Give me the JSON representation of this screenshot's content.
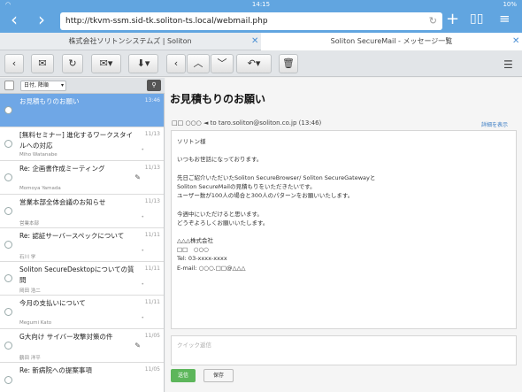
{
  "status": {
    "time": "14:15",
    "battery": "10%"
  },
  "browser": {
    "url": "http://tkvm-ssm.sid-tk.soliton-ts.local/webmail.php",
    "tabs": [
      {
        "label": "株式会社ソリトンシステムズ | Soliton"
      },
      {
        "label": "Soliton SecureMail - メッセージ一覧"
      }
    ]
  },
  "list": {
    "sort_label": "日付, 降順",
    "items": [
      {
        "subject": "お見積もりのお願い",
        "date": "13:46",
        "from": "",
        "dot": "",
        "selected": true
      },
      {
        "subject": "[無料セミナー] 進化するワークスタイルへの対応",
        "date": "11/13",
        "from": "Miho Watanabe",
        "dot": "•"
      },
      {
        "subject": "Re: 企画書作成ミーティング",
        "date": "11/13",
        "from": "Momoya Yamada",
        "dot": "",
        "clip": true
      },
      {
        "subject": "営業本部全体会議のお知らせ",
        "date": "11/13",
        "from": "営業本部",
        "dot": "•"
      },
      {
        "subject": "Re: 認証サーバースペックについて",
        "date": "11/11",
        "from": "石川 学",
        "dot": "•"
      },
      {
        "subject": "Soliton SecureDesktopについての質問",
        "date": "11/11",
        "from": "岡田 浩二",
        "dot": "•"
      },
      {
        "subject": "今月の支払いについて",
        "date": "11/11",
        "from": "Megumi Kato",
        "dot": "•"
      },
      {
        "subject": "G大向け サイバー攻撃対策の件",
        "date": "11/05",
        "from": "鶴田 洋平",
        "dot": "",
        "clip": true
      },
      {
        "subject": "Re: 新病院への提案事項",
        "date": "11/05",
        "from": "",
        "dot": ""
      }
    ]
  },
  "message": {
    "title": "お見積もりのお願い",
    "header": "□□ ○○○ ◄ to taro.soliton@soliton.co.jp (13:46)",
    "detail_link": "詳細を表示",
    "body": [
      "ソリトン様",
      "",
      "いつもお世話になっております。",
      "",
      "先日ご紹介いただいたSoliton SecureBrowser/ Soliton SecureGatewayと",
      "Soliton SecureMailの見積もりをいただきたいです。",
      "ユーザー数が100人の場合と300人のパターンをお願いいたします。",
      "",
      "今週中にいただけると思います。",
      "どうぞよろしくお願いいたします。",
      "",
      "△△△株式会社",
      "□□　○○○",
      "Tel: 03-xxxx-xxxx",
      "E-mail: ○○○.□□@△△△"
    ],
    "reply_placeholder": "クイック返信",
    "send_label": "送信",
    "save_label": "保存"
  }
}
